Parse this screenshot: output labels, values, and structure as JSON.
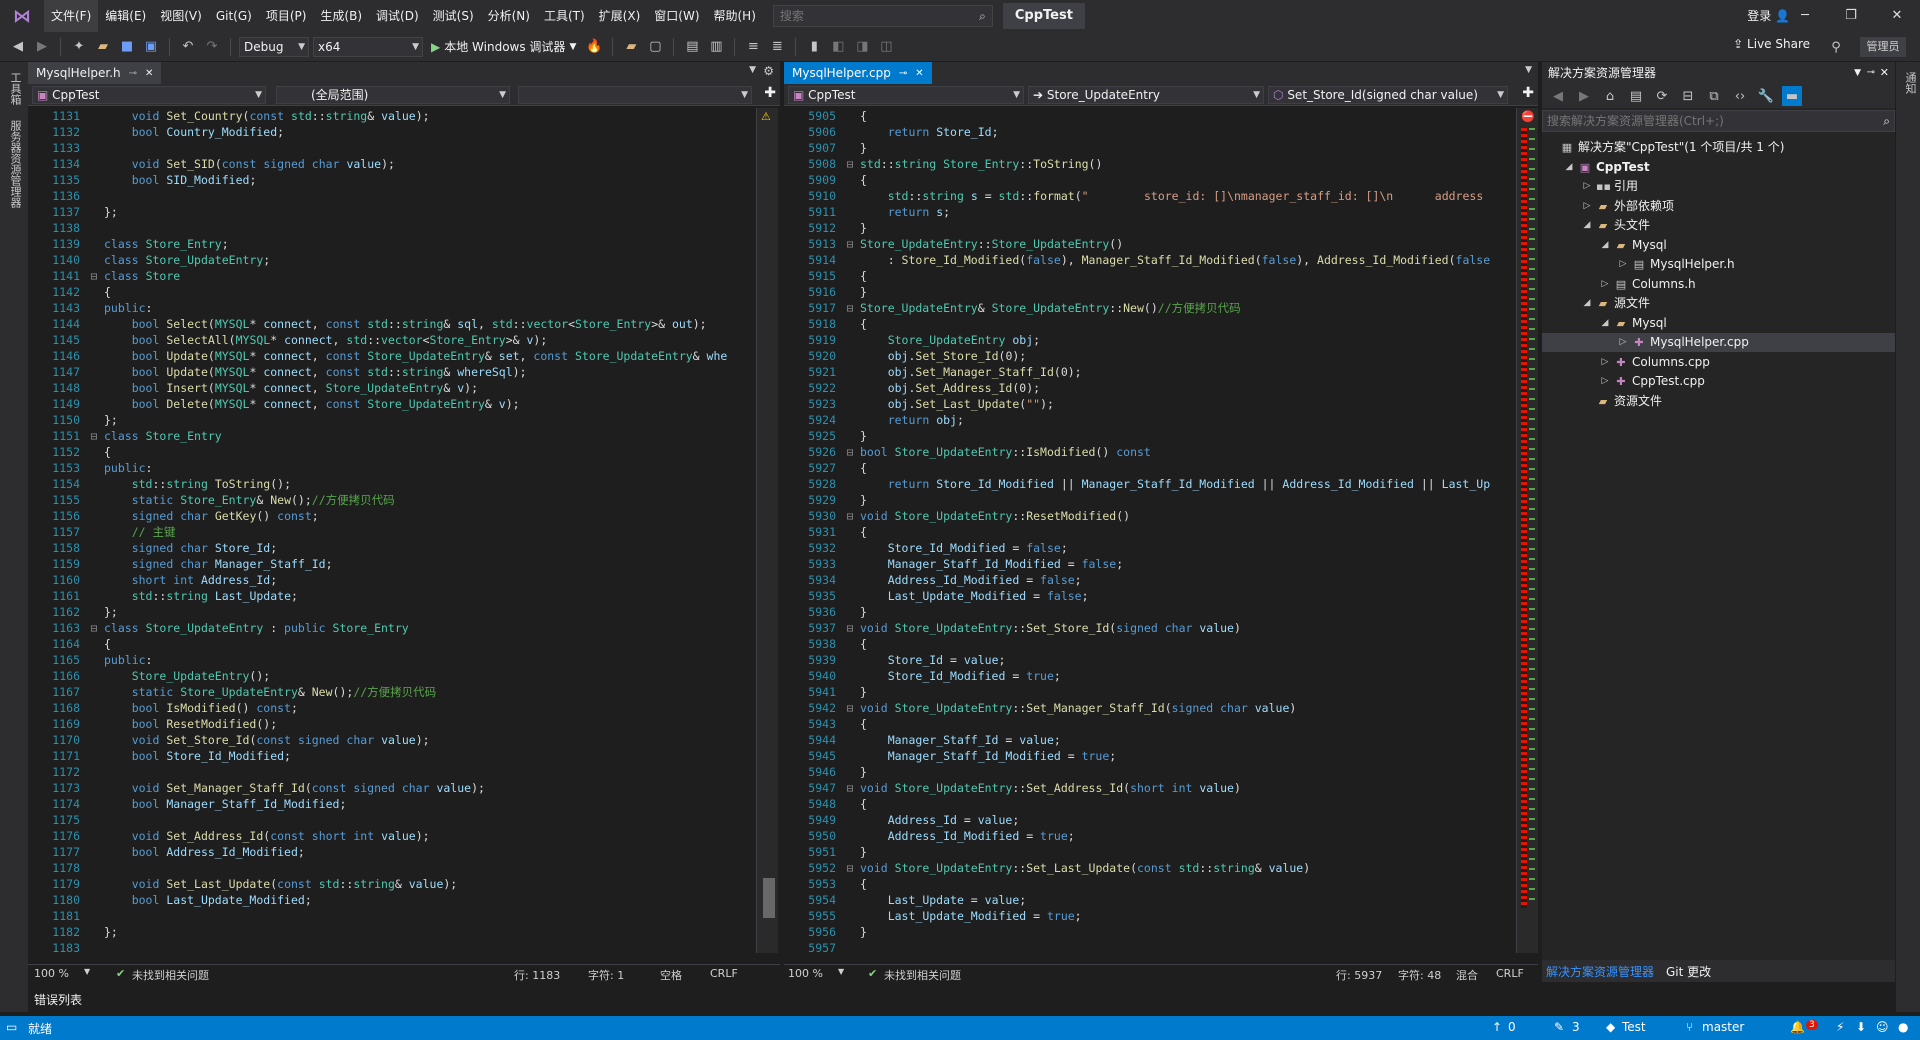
{
  "menu": [
    "文件(F)",
    "编辑(E)",
    "视图(V)",
    "Git(G)",
    "项目(P)",
    "生成(B)",
    "调试(D)",
    "测试(S)",
    "分析(N)",
    "工具(T)",
    "扩展(X)",
    "窗口(W)",
    "帮助(H)"
  ],
  "search": {
    "placeholder": "搜索"
  },
  "solution_name": "CppTest",
  "login": "登录",
  "toolbar": {
    "config": "Debug",
    "platform": "x64",
    "debug_target": "本地 Windows 调试器",
    "live_share": "Live Share",
    "admin": "管理员"
  },
  "left_strip": {
    "tab1": "工具箱",
    "tab2": "服务器资源管理器"
  },
  "left_editor": {
    "tab": "MysqlHelper.h",
    "nav_project": "CppTest",
    "nav_scope": "(全局范围)",
    "zoom": "100 %",
    "issues": "未找到相关问题",
    "row": "行: 1183",
    "col": "字符: 1",
    "spacing": "空格",
    "eol": "CRLF",
    "lines": [
      [
        "1131",
        "",
        "    void Set_Country(const std::string& value);"
      ],
      [
        "1132",
        "",
        "    bool Country_Modified;"
      ],
      [
        "1133",
        "",
        ""
      ],
      [
        "1134",
        "",
        "    void Set_SID(const signed char value);"
      ],
      [
        "1135",
        "",
        "    bool SID_Modified;"
      ],
      [
        "1136",
        "",
        ""
      ],
      [
        "1137",
        "",
        "};"
      ],
      [
        "1138",
        "",
        ""
      ],
      [
        "1139",
        "",
        "class Store_Entry;"
      ],
      [
        "1140",
        "",
        "class Store_UpdateEntry;"
      ],
      [
        "1141",
        "⊟",
        "class Store"
      ],
      [
        "1142",
        "",
        "{"
      ],
      [
        "1143",
        "",
        "public:"
      ],
      [
        "1144",
        "",
        "    bool Select(MYSQL* connect, const std::string& sql, std::vector<Store_Entry>& out);"
      ],
      [
        "1145",
        "",
        "    bool SelectAll(MYSQL* connect, std::vector<Store_Entry>& v);"
      ],
      [
        "1146",
        "",
        "    bool Update(MYSQL* connect, const Store_UpdateEntry& set, const Store_UpdateEntry& whe"
      ],
      [
        "1147",
        "",
        "    bool Update(MYSQL* connect, const std::string& whereSql);"
      ],
      [
        "1148",
        "",
        "    bool Insert(MYSQL* connect, Store_UpdateEntry& v);"
      ],
      [
        "1149",
        "",
        "    bool Delete(MYSQL* connect, const Store_UpdateEntry& v);"
      ],
      [
        "1150",
        "",
        "};"
      ],
      [
        "1151",
        "⊟",
        "class Store_Entry"
      ],
      [
        "1152",
        "",
        "{"
      ],
      [
        "1153",
        "",
        "public:"
      ],
      [
        "1154",
        "",
        "    std::string ToString();"
      ],
      [
        "1155",
        "",
        "    static Store_Entry& New();//方便拷贝代码"
      ],
      [
        "1156",
        "",
        "    signed char GetKey() const;"
      ],
      [
        "1157",
        "",
        "    // 主键"
      ],
      [
        "1158",
        "",
        "    signed char Store_Id;"
      ],
      [
        "1159",
        "",
        "    signed char Manager_Staff_Id;"
      ],
      [
        "1160",
        "",
        "    short int Address_Id;"
      ],
      [
        "1161",
        "",
        "    std::string Last_Update;"
      ],
      [
        "1162",
        "",
        "};"
      ],
      [
        "1163",
        "⊟",
        "class Store_UpdateEntry : public Store_Entry"
      ],
      [
        "1164",
        "",
        "{"
      ],
      [
        "1165",
        "",
        "public:"
      ],
      [
        "1166",
        "",
        "    Store_UpdateEntry();"
      ],
      [
        "1167",
        "",
        "    static Store_UpdateEntry& New();//方便拷贝代码"
      ],
      [
        "1168",
        "",
        "    bool IsModified() const;"
      ],
      [
        "1169",
        "",
        "    bool ResetModified();"
      ],
      [
        "1170",
        "",
        "    void Set_Store_Id(const signed char value);"
      ],
      [
        "1171",
        "",
        "    bool Store_Id_Modified;"
      ],
      [
        "1172",
        "",
        ""
      ],
      [
        "1173",
        "",
        "    void Set_Manager_Staff_Id(const signed char value);"
      ],
      [
        "1174",
        "",
        "    bool Manager_Staff_Id_Modified;"
      ],
      [
        "1175",
        "",
        ""
      ],
      [
        "1176",
        "",
        "    void Set_Address_Id(const short int value);"
      ],
      [
        "1177",
        "",
        "    bool Address_Id_Modified;"
      ],
      [
        "1178",
        "",
        ""
      ],
      [
        "1179",
        "",
        "    void Set_Last_Update(const std::string& value);"
      ],
      [
        "1180",
        "",
        "    bool Last_Update_Modified;"
      ],
      [
        "1181",
        "",
        ""
      ],
      [
        "1182",
        "",
        "};"
      ],
      [
        "1183",
        "",
        ""
      ]
    ]
  },
  "right_editor": {
    "tab": "MysqlHelper.cpp",
    "nav_project": "CppTest",
    "nav_class": "Store_UpdateEntry",
    "nav_member": "Set_Store_Id(signed char value)",
    "zoom": "100 %",
    "issues": "未找到相关问题",
    "row": "行: 5937",
    "col": "字符: 48",
    "spacing": "混合",
    "eol": "CRLF",
    "lines": [
      [
        "5905",
        "",
        "{"
      ],
      [
        "5906",
        "",
        "    return Store_Id;"
      ],
      [
        "5907",
        "",
        "}"
      ],
      [
        "5908",
        "⊟",
        "std::string Store_Entry::ToString()"
      ],
      [
        "5909",
        "",
        "{"
      ],
      [
        "5910",
        "",
        "    std::string s = std::format(\"        store_id: []\\nmanager_staff_id: []\\n      address"
      ],
      [
        "5911",
        "",
        "    return s;"
      ],
      [
        "5912",
        "",
        "}"
      ],
      [
        "5913",
        "⊟",
        "Store_UpdateEntry::Store_UpdateEntry()"
      ],
      [
        "5914",
        "",
        "    : Store_Id_Modified(false), Manager_Staff_Id_Modified(false), Address_Id_Modified(false"
      ],
      [
        "5915",
        "",
        "{"
      ],
      [
        "5916",
        "",
        "}"
      ],
      [
        "5917",
        "⊟",
        "Store_UpdateEntry& Store_UpdateEntry::New()//方便拷贝代码"
      ],
      [
        "5918",
        "",
        "{"
      ],
      [
        "5919",
        "",
        "    Store_UpdateEntry obj;"
      ],
      [
        "5920",
        "",
        "    obj.Set_Store_Id(0);"
      ],
      [
        "5921",
        "",
        "    obj.Set_Manager_Staff_Id(0);"
      ],
      [
        "5922",
        "",
        "    obj.Set_Address_Id(0);"
      ],
      [
        "5923",
        "",
        "    obj.Set_Last_Update(\"\");"
      ],
      [
        "5924",
        "",
        "    return obj;"
      ],
      [
        "5925",
        "",
        "}"
      ],
      [
        "5926",
        "⊟",
        "bool Store_UpdateEntry::IsModified() const"
      ],
      [
        "5927",
        "",
        "{"
      ],
      [
        "5928",
        "",
        "    return Store_Id_Modified || Manager_Staff_Id_Modified || Address_Id_Modified || Last_Up"
      ],
      [
        "5929",
        "",
        "}"
      ],
      [
        "5930",
        "⊟",
        "void Store_UpdateEntry::ResetModified()"
      ],
      [
        "5931",
        "",
        "{"
      ],
      [
        "5932",
        "",
        "    Store_Id_Modified = false;"
      ],
      [
        "5933",
        "",
        "    Manager_Staff_Id_Modified = false;"
      ],
      [
        "5934",
        "",
        "    Address_Id_Modified = false;"
      ],
      [
        "5935",
        "",
        "    Last_Update_Modified = false;"
      ],
      [
        "5936",
        "",
        "}"
      ],
      [
        "5937",
        "⊟",
        "void Store_UpdateEntry::Set_Store_Id(signed char value)"
      ],
      [
        "5938",
        "",
        "{"
      ],
      [
        "5939",
        "",
        "    Store_Id = value;"
      ],
      [
        "5940",
        "",
        "    Store_Id_Modified = true;"
      ],
      [
        "5941",
        "",
        "}"
      ],
      [
        "5942",
        "⊟",
        "void Store_UpdateEntry::Set_Manager_Staff_Id(signed char value)"
      ],
      [
        "5943",
        "",
        "{"
      ],
      [
        "5944",
        "",
        "    Manager_Staff_Id = value;"
      ],
      [
        "5945",
        "",
        "    Manager_Staff_Id_Modified = true;"
      ],
      [
        "5946",
        "",
        "}"
      ],
      [
        "5947",
        "⊟",
        "void Store_UpdateEntry::Set_Address_Id(short int value)"
      ],
      [
        "5948",
        "",
        "{"
      ],
      [
        "5949",
        "",
        "    Address_Id = value;"
      ],
      [
        "5950",
        "",
        "    Address_Id_Modified = true;"
      ],
      [
        "5951",
        "",
        "}"
      ],
      [
        "5952",
        "⊟",
        "void Store_UpdateEntry::Set_Last_Update(const std::string& value)"
      ],
      [
        "5953",
        "",
        "{"
      ],
      [
        "5954",
        "",
        "    Last_Update = value;"
      ],
      [
        "5955",
        "",
        "    Last_Update_Modified = true;"
      ],
      [
        "5956",
        "",
        "}"
      ],
      [
        "5957",
        "",
        ""
      ]
    ]
  },
  "solution_explorer": {
    "title": "解决方案资源管理器",
    "search_placeholder": "搜索解决方案资源管理器(Ctrl+;)",
    "tree": [
      {
        "label": "解决方案\"CppTest\"(1 个项目/共 1 个)",
        "level": 0,
        "twisty": "",
        "icon": "solution",
        "bold": false
      },
      {
        "label": "CppTest",
        "level": 1,
        "twisty": "◢",
        "icon": "project",
        "bold": true
      },
      {
        "label": "引用",
        "level": 2,
        "twisty": "▷",
        "icon": "references",
        "bold": false
      },
      {
        "label": "外部依赖项",
        "level": 2,
        "twisty": "▷",
        "icon": "folder",
        "bold": false
      },
      {
        "label": "头文件",
        "level": 2,
        "twisty": "◢",
        "icon": "folder",
        "bold": false
      },
      {
        "label": "Mysql",
        "level": 3,
        "twisty": "◢",
        "icon": "folder",
        "bold": false
      },
      {
        "label": "MysqlHelper.h",
        "level": 4,
        "twisty": "▷",
        "icon": "h",
        "bold": false
      },
      {
        "label": "Columns.h",
        "level": 3,
        "twisty": "▷",
        "icon": "h",
        "bold": false
      },
      {
        "label": "源文件",
        "level": 2,
        "twisty": "◢",
        "icon": "folder",
        "bold": false
      },
      {
        "label": "Mysql",
        "level": 3,
        "twisty": "◢",
        "icon": "folder",
        "bold": false
      },
      {
        "label": "MysqlHelper.cpp",
        "level": 4,
        "twisty": "▷",
        "icon": "cpp",
        "bold": false,
        "selected": true
      },
      {
        "label": "Columns.cpp",
        "level": 3,
        "twisty": "▷",
        "icon": "cpp",
        "bold": false
      },
      {
        "label": "CppTest.cpp",
        "level": 3,
        "twisty": "▷",
        "icon": "cpp",
        "bold": false
      },
      {
        "label": "资源文件",
        "level": 2,
        "twisty": "",
        "icon": "folder",
        "bold": false
      }
    ],
    "bottom_tab1": "解决方案资源管理器",
    "bottom_tab2": "Git 更改"
  },
  "error_list_tab": "错误列表",
  "statusbar": {
    "ready": "就绪",
    "up": "0",
    "pencil": "3",
    "branch_repo": "Test",
    "branch": "master",
    "notifications": "3"
  },
  "colors": {
    "accent": "#007acc",
    "bg": "#1e1e1e",
    "chrome": "#2d2d30"
  }
}
